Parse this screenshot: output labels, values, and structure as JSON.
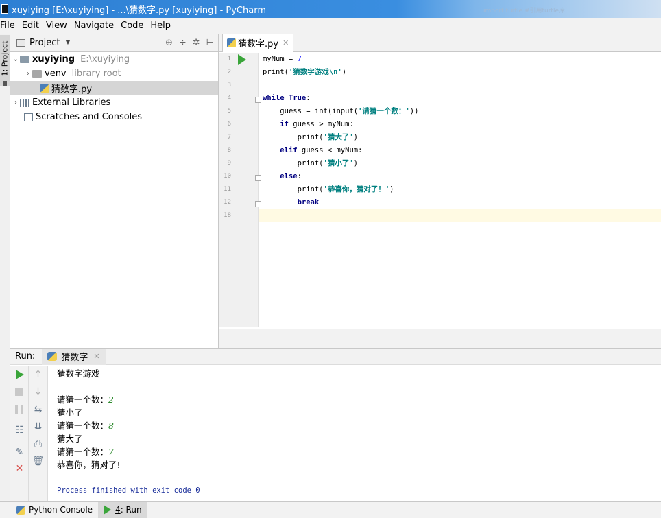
{
  "window": {
    "title": "xuyiying [E:\\xuyiying] - ...\\猜数字.py [xuyiying] - PyCharm",
    "blurred_text": "import turtle #引用turtle库"
  },
  "menu": [
    "File",
    "Edit",
    "View",
    "Navigate",
    "Code",
    "Help"
  ],
  "sidebar_tab": "1: Project",
  "project": {
    "header": "Project",
    "root_name": "xuyiying",
    "root_path": "E:\\xuyiying",
    "venv_name": "venv",
    "venv_note": "library root",
    "file_name": "猜数字.py",
    "ext_libs": "External Libraries",
    "scratches": "Scratches and Consoles"
  },
  "editor": {
    "tab_label": "猜数字.py",
    "line_numbers": [
      "1",
      "2",
      "3",
      "4",
      "5",
      "6",
      "7",
      "8",
      "9",
      "10",
      "11",
      "12",
      "18"
    ],
    "lines": [
      {
        "indent": "",
        "a": "myNum = ",
        "num": "7"
      },
      {
        "indent": "",
        "a": "print(",
        "str": "'猜数字游戏\\n'",
        "b": ")"
      },
      {
        "indent": ""
      },
      {
        "indent": "",
        "kw": "while ",
        "kw2": "True",
        "b": ":"
      },
      {
        "indent": "    ",
        "a": "guess = int(input(",
        "str": "'请猜一个数：'",
        "b": "))"
      },
      {
        "indent": "    ",
        "kw": "if ",
        "a": "guess > myNum:"
      },
      {
        "indent": "        ",
        "a": "print(",
        "str": "'猜大了'",
        "b": ")"
      },
      {
        "indent": "    ",
        "kw": "elif ",
        "a": "guess < myNum:"
      },
      {
        "indent": "        ",
        "a": "print(",
        "str": "'猜小了'",
        "b": ")"
      },
      {
        "indent": "    ",
        "kw": "else",
        "a": ":"
      },
      {
        "indent": "        ",
        "a": "print(",
        "str": "'恭喜你，猜对了！'",
        "b": ")"
      },
      {
        "indent": "        ",
        "kw": "break"
      },
      {
        "indent": ""
      }
    ]
  },
  "run": {
    "label": "Run:",
    "tab": "猜数字",
    "console": [
      {
        "text": "猜数字游戏"
      },
      {
        "text": ""
      },
      {
        "text": "请猜一个数：",
        "input": "2"
      },
      {
        "text": "猜小了"
      },
      {
        "text": "请猜一个数：",
        "input": "8"
      },
      {
        "text": "猜大了"
      },
      {
        "text": "请猜一个数：",
        "input": "7"
      },
      {
        "text": "恭喜你，猜对了!"
      },
      {
        "text": ""
      }
    ],
    "exit_message": "Process finished with exit code 0"
  },
  "bottom_tabs": {
    "python_console": "Python Console",
    "run_prefix": "4",
    "run_label": ": Run"
  }
}
